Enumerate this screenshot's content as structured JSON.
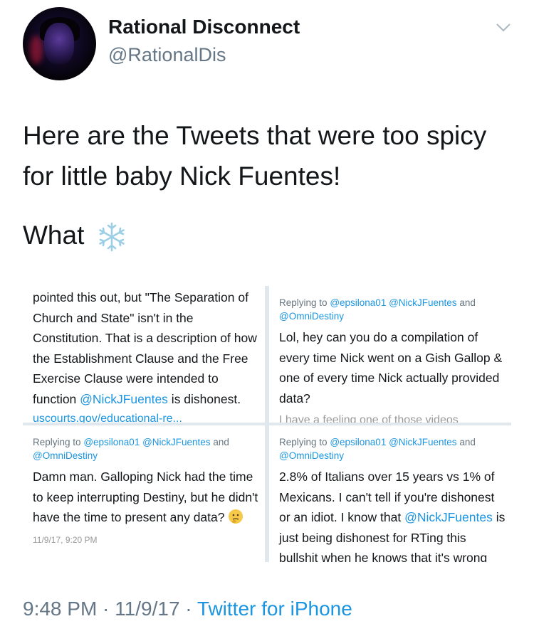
{
  "header": {
    "display_name": "Rational Disconnect",
    "handle": "@RationalDis",
    "menu_icon": "chevron-down-icon"
  },
  "tweet": {
    "text_line1": "Here are the Tweets that were too spicy for little baby Nick Fuentes!",
    "text_line2": "What",
    "emoji": "snowflake-icon"
  },
  "media": {
    "cell1": {
      "body_before": "pointed this out, but \"The Separation of Church and State\" isn't in the Constitution. That is a description of how the Establishment Clause and the Free Exercise Clause were intended to function ",
      "mention": "@NickJFuentes",
      "body_after": " is dishonest.",
      "link": "uscourts.gov/educational-re..."
    },
    "cell2": {
      "replying_label": "Replying to",
      "replying_mentions": "@epsilona01 @NickJFuentes",
      "replying_and": "and",
      "replying_mention2": "@OmniDestiny",
      "body": "Lol, hey can you do a compilation of every time Nick went on a Gish Gallop & one of every time Nick actually provided data?",
      "cut_text": "I have a feeling one of those videos"
    },
    "cell3": {
      "replying_label": "Replying to",
      "replying_mentions": "@epsilona01 @NickJFuentes",
      "replying_and": "and",
      "replying_mention2": "@OmniDestiny",
      "body": "Damn man. Galloping Nick had the time to keep interrupting Destiny, but he didn't have the time to present any data?",
      "emoji": "thinking-face-icon",
      "timestamp": "11/9/17, 9:20 PM"
    },
    "cell4": {
      "replying_label": "Replying to",
      "replying_mentions": "@epsilona01 @NickJFuentes",
      "replying_and": "and",
      "replying_mention2": "@OmniDestiny",
      "body_before": "2.8% of Italians over 15 years vs 1% of Mexicans. I can't tell if you're dishonest or an idiot. I know that ",
      "mention": "@NickJFuentes",
      "body_after": " is just being dishonest for RTing this",
      "cut_text": "bullshit when he knows that it's wrong"
    }
  },
  "footer": {
    "time": "9:48 PM",
    "sep1": " · ",
    "date": "11/9/17",
    "sep2": " · ",
    "source": "Twitter for iPhone"
  }
}
